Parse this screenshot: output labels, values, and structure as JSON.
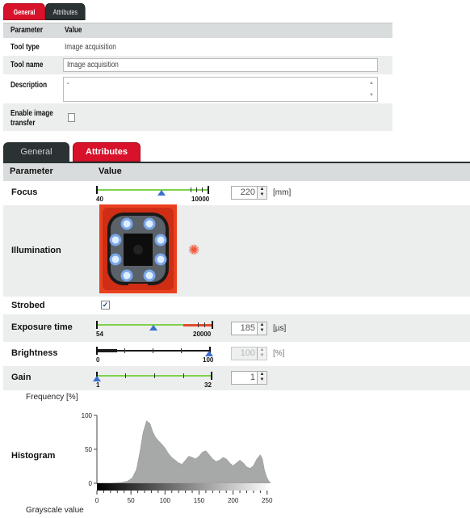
{
  "small_panel": {
    "tabs": [
      {
        "label": "General",
        "active": true
      },
      {
        "label": "Attributes",
        "active": false
      }
    ],
    "header": {
      "param": "Parameter",
      "value": "Value"
    },
    "rows": {
      "tool_type": {
        "label": "Tool type",
        "value": "Image acquisition"
      },
      "tool_name": {
        "label": "Tool name",
        "value": "Image acquisition"
      },
      "description": {
        "label": "Description",
        "value": "-"
      },
      "enable_image_transfer": {
        "label_line1": "Enable image",
        "label_line2": "transfer",
        "checked": false
      }
    }
  },
  "main_panel": {
    "tabs": [
      {
        "label": "General",
        "active": false
      },
      {
        "label": "Attributes",
        "active": true
      }
    ],
    "header": {
      "param": "Parameter",
      "value": "Value"
    },
    "focus": {
      "label": "Focus",
      "min": "40",
      "max": "10000",
      "value": "220",
      "unit": "[mm]",
      "level": 0.55
    },
    "illumination": {
      "label": "Illumination",
      "icon": "camera-illumination-image",
      "gear_icon": "gear-icon"
    },
    "strobed": {
      "label": "Strobed",
      "checked": true
    },
    "exposure_time": {
      "label": "Exposure time",
      "min": "54",
      "max": "20000",
      "value": "185",
      "unit": "[µs]",
      "level": 0.6
    },
    "brightness": {
      "label": "Brightness",
      "min": "0",
      "max": "100",
      "value": "100",
      "unit": "[%]",
      "disabled": true,
      "level": 1.0
    },
    "gain": {
      "label": "Gain",
      "min": "1",
      "max": "32",
      "value": "1",
      "level": 0.0
    },
    "histogram": {
      "label": "Histogram",
      "y_title": "Frequency [%]",
      "x_title": "Grayscale value",
      "y_ticks": [
        "100",
        "50",
        "0"
      ],
      "x_ticks": [
        "0",
        "50",
        "100",
        "150",
        "200",
        "250"
      ]
    }
  },
  "colors": {
    "accent": "#d7122a",
    "tab_dark": "#2b3234",
    "slider_green": "#7ed14d",
    "slider_red": "#e34a2b",
    "thumb_blue": "#3a6fd0"
  },
  "chart_data": {
    "type": "area",
    "title": "",
    "xlabel": "Grayscale value",
    "ylabel": "Frequency [%]",
    "xlim": [
      0,
      255
    ],
    "ylim": [
      0,
      100
    ],
    "x_ticks": [
      0,
      50,
      100,
      150,
      200,
      250
    ],
    "y_ticks": [
      0,
      50,
      100
    ],
    "series": [
      {
        "x": [
          0,
          20,
          35,
          45,
          52,
          58,
          63,
          68,
          73,
          78,
          82,
          86,
          90,
          95,
          100,
          105,
          110,
          115,
          120,
          125,
          130,
          135,
          140,
          145,
          150,
          155,
          160,
          165,
          170,
          175,
          180,
          185,
          190,
          195,
          200,
          205,
          210,
          215,
          220,
          225,
          230,
          235,
          240,
          243,
          246,
          249,
          252,
          255
        ],
        "values": [
          0,
          0,
          1,
          3,
          8,
          20,
          45,
          75,
          92,
          88,
          76,
          68,
          63,
          58,
          52,
          44,
          38,
          34,
          30,
          28,
          34,
          40,
          38,
          36,
          40,
          46,
          48,
          42,
          36,
          32,
          34,
          38,
          36,
          30,
          26,
          30,
          34,
          30,
          24,
          22,
          26,
          36,
          42,
          36,
          20,
          10,
          4,
          0
        ]
      }
    ]
  }
}
